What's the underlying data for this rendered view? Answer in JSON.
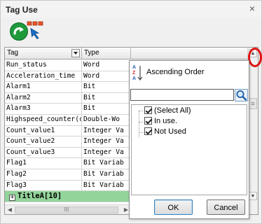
{
  "window": {
    "title": "Tag Use",
    "close_symbol": "×"
  },
  "grid": {
    "columns": {
      "tag": "Tag",
      "type": "Type"
    },
    "rows": [
      {
        "tag": "Run_status",
        "type": "Word"
      },
      {
        "tag": "Acceleration_time",
        "type": "Word"
      },
      {
        "tag": "Alarm1",
        "type": "Bit"
      },
      {
        "tag": "Alarm2",
        "type": "Bit"
      },
      {
        "tag": "Alarm3",
        "type": "Bit"
      },
      {
        "tag": "Highspeed_counter(cu",
        "type": "Double-Wo"
      },
      {
        "tag": "Count_value1",
        "type": "Integer Va"
      },
      {
        "tag": "Count_value2",
        "type": "Integer Va"
      },
      {
        "tag": "Count_value3",
        "type": "Integer Va"
      },
      {
        "tag": "Flag1",
        "type": "Bit Variab"
      },
      {
        "tag": "Flag2",
        "type": "Bit Variab"
      },
      {
        "tag": "Flag3",
        "type": "Bit Variab"
      }
    ],
    "group_row": {
      "expander": "+",
      "label": "TitleA[10]"
    },
    "hscroll": {
      "thumb_grip": "III"
    },
    "vscroll": {
      "grip": "≡"
    }
  },
  "filter_popup": {
    "sort_label": "Ascending Order",
    "search_value": "",
    "items": [
      {
        "label": "(Select All)",
        "checked": true
      },
      {
        "label": "In use.",
        "checked": true
      },
      {
        "label": "Not Used",
        "checked": true
      }
    ],
    "ok_label": "OK",
    "cancel_label": "Cancel"
  },
  "colors": {
    "group_row_bg": "#93d49a",
    "highlight_ring": "#e01010",
    "next_icon": "#1e9a3c"
  }
}
